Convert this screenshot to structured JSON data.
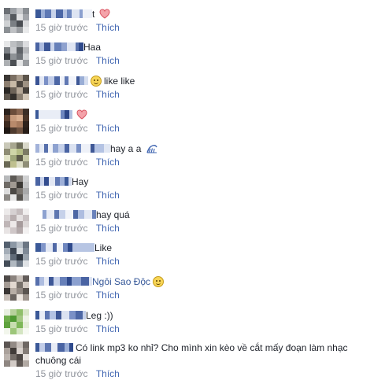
{
  "time_ago": "15 giờ trước",
  "like_label": "Thích",
  "comments": [
    {
      "suffix": "t",
      "text": "",
      "icon": "heart-icon"
    },
    {
      "suffix": "",
      "text": "Haa",
      "icon": ""
    },
    {
      "suffix": "",
      "text": "like like",
      "icon": "smile-icon"
    },
    {
      "suffix": "",
      "text": "",
      "icon": "heart-icon"
    },
    {
      "suffix": "",
      "text": "hay a a",
      "icon": "wave-icon"
    },
    {
      "suffix": "",
      "text": "Hay",
      "icon": ""
    },
    {
      "suffix": "",
      "text": "hay quá",
      "icon": ""
    },
    {
      "suffix": "",
      "text": "Like",
      "icon": ""
    },
    {
      "suffix": "",
      "text": "Ngôi Sao Độc",
      "icon": "smile-icon",
      "tagged": true
    },
    {
      "suffix": "",
      "text": "Leg :))",
      "icon": ""
    },
    {
      "suffix": "",
      "text": "Có link mp3 ko nhỉ? Cho mình xin kèo về cắt mấy đoạn làm nhạc",
      "text2": "chuông cái",
      "icon": ""
    }
  ],
  "colors": {
    "like_link": "#4267b2",
    "meta_gray": "#90949c",
    "name_blue": "#365899"
  }
}
